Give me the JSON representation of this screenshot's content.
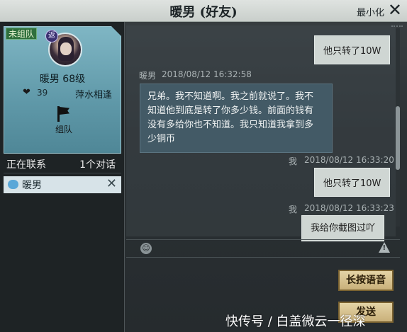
{
  "window": {
    "title": "暖男 (好友)",
    "minimize_label": "最小化",
    "close_glyph": "✕"
  },
  "profile": {
    "team_status": "未组队",
    "school_glyph": "返",
    "name_level": "暖男  68级",
    "friendship_value": "39",
    "relation": "萍水相逢",
    "team_button_label": "组队"
  },
  "contacts": {
    "header_left": "正在联系",
    "header_right": "1个对话",
    "items": [
      {
        "name": "暖男"
      }
    ]
  },
  "chat": {
    "messages": [
      {
        "side": "right",
        "text": "他只转了10W"
      },
      {
        "side": "left",
        "sender": "暖男",
        "time": "2018/08/12  16:32:58",
        "lines": [
          "兄弟。我不知道啊。我之前就说了。我不",
          "知道他到底是转了你多少钱。前面的钱有",
          "没有多给你也不知道。我只知道我拿到多",
          "少铜币"
        ]
      },
      {
        "side": "right",
        "sender": "我",
        "time": "2018/08/12  16:33:20",
        "text": "他只转了10W"
      },
      {
        "side": "right",
        "sender": "我",
        "time": "2018/08/12  16:33:23",
        "text": "我给你截图过吖"
      }
    ]
  },
  "input": {
    "voice_button": "长按语音",
    "send_button": "发送"
  },
  "watermark": "快传号 / 白盖微云一径深",
  "icons": {
    "emoji": "emoji-icon",
    "warning": "warning-icon",
    "heart": "heart-icon"
  }
}
